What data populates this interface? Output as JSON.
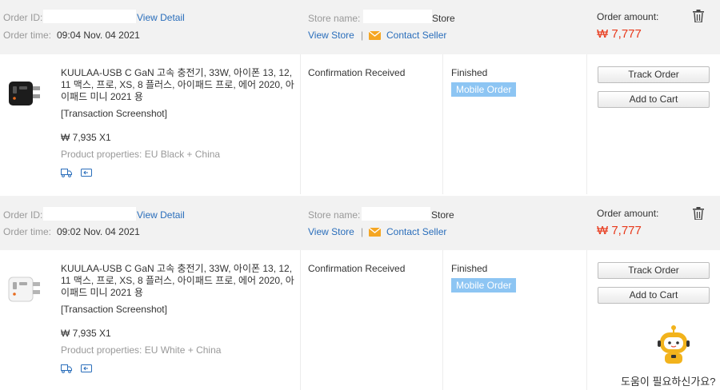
{
  "orders": [
    {
      "order_id_label": "Order ID:",
      "view_detail": "View Detail",
      "order_time_label": "Order time:",
      "order_time": "09:04 Nov. 04 2021",
      "store_name_label": "Store name:",
      "store_suffix": "Store",
      "view_store": "View Store",
      "separator": "|",
      "contact_seller": "Contact Seller",
      "order_amount_label": "Order amount:",
      "order_amount": "₩ 7,777",
      "product_title": "KUULAA-USB C GaN 고속 충전기, 33W, 아이폰 13, 12, 11 맥스, 프로, XS, 8 플러스, 아이패드 프로, 에어 2020, 아이패드 미니 2021 용",
      "transaction_screenshot": "[Transaction Screenshot]",
      "price_qty": "₩ 7,935 X1",
      "product_properties": "Product properties: EU Black + China",
      "status": "Confirmation Received",
      "state": "Finished",
      "badge": "Mobile Order",
      "track_order": "Track Order",
      "add_to_cart": "Add to Cart",
      "product_color": "#1c1c1c"
    },
    {
      "order_id_label": "Order ID:",
      "view_detail": "View Detail",
      "order_time_label": "Order time:",
      "order_time": "09:02 Nov. 04 2021",
      "store_name_label": "Store name:",
      "store_suffix": "Store",
      "view_store": "View Store",
      "separator": "|",
      "contact_seller": "Contact Seller",
      "order_amount_label": "Order amount:",
      "order_amount": "₩ 7,777",
      "product_title": "KUULAA-USB C GaN 고속 충전기, 33W, 아이폰 13, 12, 11 맥스, 프로, XS, 8 플러스, 아이패드 프로, 에어 2020, 아이패드 미니 2021 용",
      "transaction_screenshot": "[Transaction Screenshot]",
      "price_qty": "₩ 7,935 X1",
      "product_properties": "Product properties: EU White + China",
      "status": "Confirmation Received",
      "state": "Finished",
      "badge": "Mobile Order",
      "track_order": "Track Order",
      "add_to_cart": "Add to Cart",
      "product_color": "#f4f4f4"
    }
  ],
  "help_widget": {
    "text": "도움이 필요하신가요?",
    "icon": "robot-mascot-icon"
  },
  "colors": {
    "link": "#2a6ebb",
    "amount": "#e8391b",
    "badge": "#8dc5f3",
    "header_bg": "#f2f2f2",
    "mail_icon": "#f5a623"
  }
}
